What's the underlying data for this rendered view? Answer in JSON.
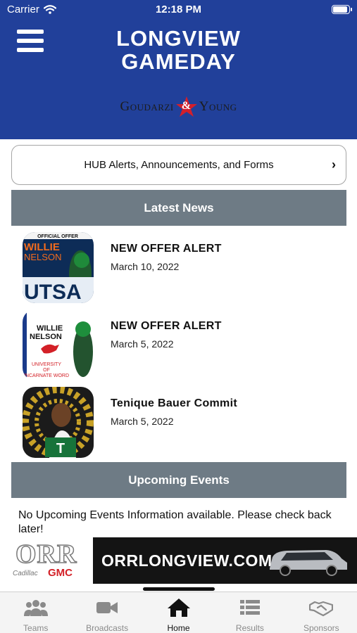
{
  "status_bar": {
    "carrier": "Carrier",
    "time": "12:18 PM",
    "battery_level": 1.0
  },
  "header": {
    "title_line1": "LONGVIEW",
    "title_line2": "GAMEDAY",
    "sponsor_left": "Goudarzi",
    "sponsor_amp": "&",
    "sponsor_right": "Young"
  },
  "hub_button": {
    "label": "HUB Alerts, Announcements, and Forms"
  },
  "latest_news": {
    "heading": "Latest News",
    "items": [
      {
        "title": "NEW OFFER ALERT",
        "date": "March 10, 2022",
        "thumb_tag": "OFFICIAL OFFER",
        "thumb_name1": "WILLIE",
        "thumb_name2": "NELSON",
        "thumb_school": "UTSA"
      },
      {
        "title": "NEW OFFER ALERT",
        "date": "March 5, 2022",
        "thumb_name1": "WILLIE",
        "thumb_name2": "NELSON",
        "thumb_school1": "UNIVERSITY",
        "thumb_school2": "OF",
        "thumb_school3": "INCARNATE WORD"
      },
      {
        "title": "Tenique Bauer Commit",
        "date": "March 5, 2022"
      }
    ]
  },
  "upcoming_events": {
    "heading": "Upcoming Events",
    "message": "No Upcoming Events Information available. Please check back later!"
  },
  "ad": {
    "brand": "ORR",
    "sub_brand": "Cadillac",
    "sub_brand2": "GMC",
    "url": "ORRLONGVIEW.COM"
  },
  "tabs": [
    {
      "label": "Teams",
      "icon": "people-icon",
      "active": false
    },
    {
      "label": "Broadcasts",
      "icon": "video-camera-icon",
      "active": false
    },
    {
      "label": "Home",
      "icon": "house-icon",
      "active": true
    },
    {
      "label": "Results",
      "icon": "list-icon",
      "active": false
    },
    {
      "label": "Sponsors",
      "icon": "handshake-icon",
      "active": false
    }
  ],
  "colors": {
    "header_bg": "#21409a",
    "section_bar": "#6e7b85",
    "sponsor_star": "#d31f2b",
    "ad_dark": "#141414"
  }
}
